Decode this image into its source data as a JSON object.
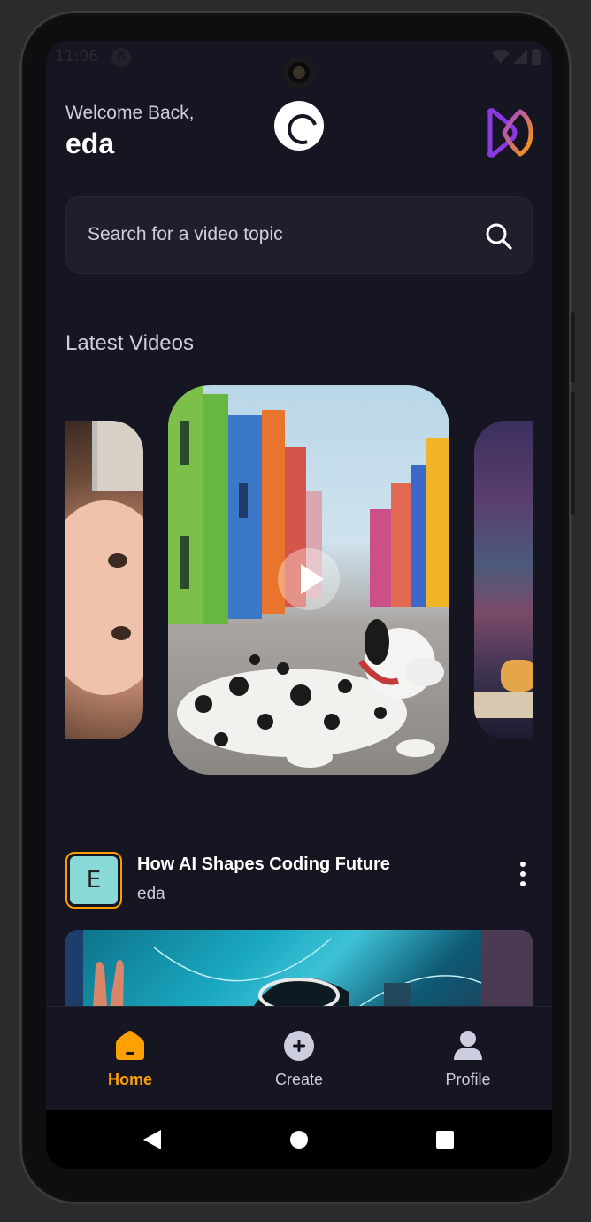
{
  "status_bar": {
    "time": "11:06",
    "notification_icon": "A"
  },
  "header": {
    "welcome_text": "Welcome Back,",
    "username": "eda",
    "loading_icon": "loading-spinner-icon",
    "brand_logo": "app-logo-icon"
  },
  "search": {
    "placeholder": "Search for a video topic",
    "icon": "search-icon"
  },
  "latest": {
    "title": "Latest Videos",
    "cards": [
      {
        "description": "baby face close-up"
      },
      {
        "description": "dalmatian dog on colorful street",
        "active": true
      },
      {
        "description": "hands typing on keyboard with neon screen"
      }
    ]
  },
  "video": {
    "avatar_letter": "E",
    "title": "How AI Shapes Coding Future",
    "creator": "eda",
    "menu_icon": "more-vertical-icon"
  },
  "tabs": [
    {
      "label": "Home",
      "icon": "home-icon",
      "active": true
    },
    {
      "label": "Create",
      "icon": "plus-circle-icon",
      "active": false
    },
    {
      "label": "Profile",
      "icon": "profile-icon",
      "active": false
    }
  ],
  "colors": {
    "background": "#161622",
    "accent": "#FF9C01",
    "text_secondary": "#CDCDE0",
    "search_bg": "#1E1E2D"
  }
}
